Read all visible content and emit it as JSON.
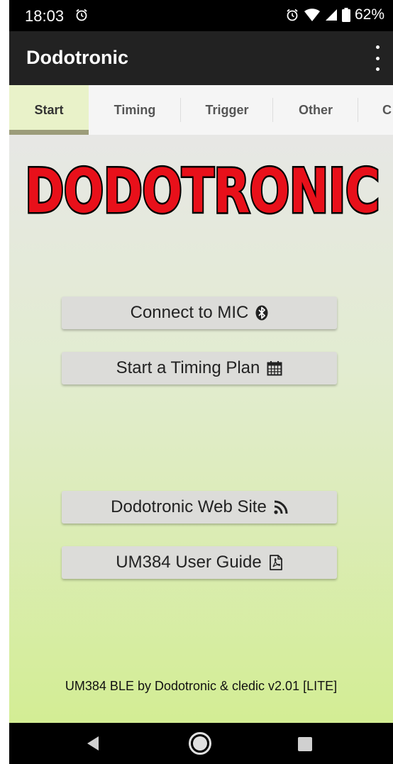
{
  "status_bar": {
    "time": "18:03",
    "alarm_icon": "alarm-clock-icon",
    "wifi_icon": "wifi-icon",
    "signal_icon": "cell-signal-icon",
    "battery_icon": "battery-icon",
    "battery_level": "62%"
  },
  "app_bar": {
    "title": "Dodotronic",
    "menu_icon": "overflow-menu-icon"
  },
  "tabs": [
    {
      "label": "Start",
      "active": true
    },
    {
      "label": "Timing",
      "active": false
    },
    {
      "label": "Trigger",
      "active": false
    },
    {
      "label": "Other",
      "active": false
    },
    {
      "label": "C",
      "active": false
    }
  ],
  "logo": {
    "text": "DODOTRONIC",
    "fill_color": "#e8101a",
    "shadow_color": "#000000"
  },
  "buttons": {
    "connect": {
      "label": "Connect to MIC",
      "icon": "bluetooth-icon"
    },
    "timing_plan": {
      "label": "Start a Timing Plan",
      "icon": "calendar-icon"
    },
    "web_site": {
      "label": "Dodotronic Web Site",
      "icon": "rss-icon"
    },
    "user_guide": {
      "label": "UM384 User Guide",
      "icon": "pdf-file-icon"
    }
  },
  "footer": {
    "text": "UM384 BLE by Dodotronic & cledic v2.01 [LITE]"
  },
  "nav_bar": {
    "back_icon": "back-triangle-icon",
    "home_icon": "home-circle-icon",
    "recents_icon": "recents-square-icon"
  },
  "colors": {
    "app_bar": "#222222",
    "status_bar": "#000000",
    "tab_indicator": "#9c9c7a",
    "active_tab_bg": "#e9f2c9",
    "gradient_top": "#e7e7e5",
    "gradient_bottom": "#d3ed94",
    "button_bg": "#dcdcd9"
  }
}
